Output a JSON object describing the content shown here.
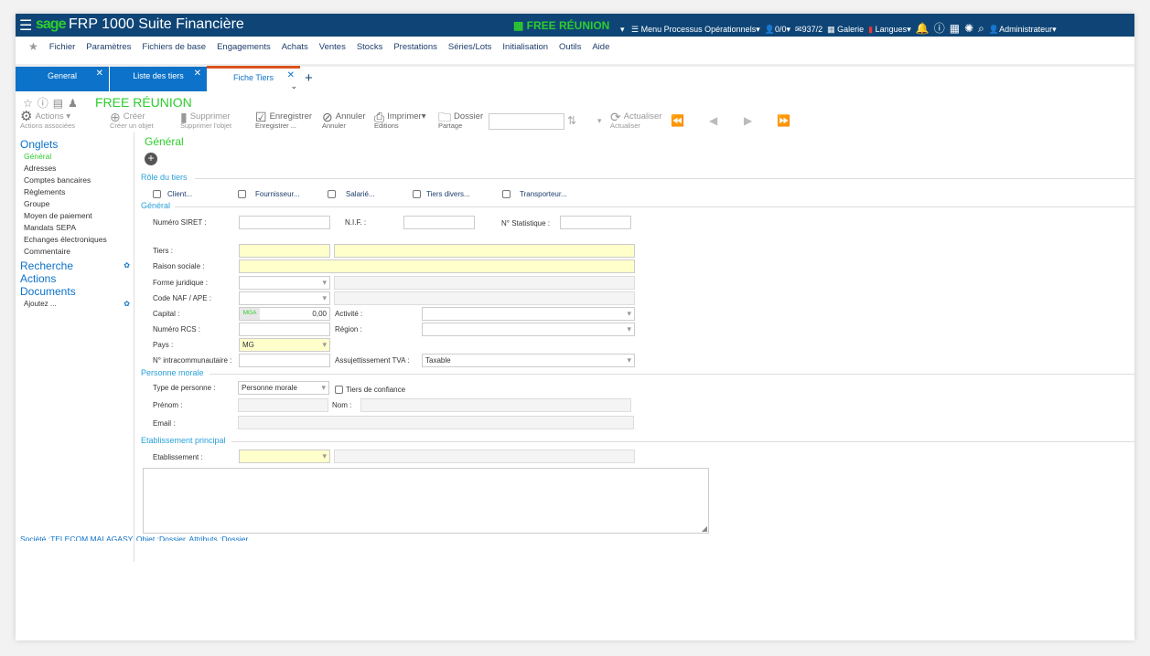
{
  "header": {
    "brand": "sage",
    "product": "FRP 1000 Suite Financière",
    "company": "FREE RÉUNION",
    "menu_processus": "Menu Processus Opérationnels",
    "users": "0/0",
    "mail": "937/2",
    "gallery": "Galerie",
    "languages": "Langues",
    "user": "Administrateur"
  },
  "menu": [
    "Fichier",
    "Paramètres",
    "Fichiers de base",
    "Engagements",
    "Achats",
    "Ventes",
    "Stocks",
    "Prestations",
    "Séries/Lots",
    "Initialisation",
    "Outils",
    "Aide"
  ],
  "tabs": [
    {
      "label": "General"
    },
    {
      "label": "Liste des tiers"
    },
    {
      "label": "Fiche Tiers"
    }
  ],
  "page_title": "FREE RÉUNION",
  "toolbar": {
    "actions": "Actions",
    "actions_sub": "Actions associées",
    "creer": "Créer",
    "creer_sub": "Créer un objet",
    "supprimer": "Supprimer",
    "supprimer_sub": "Supprimer l'objet",
    "enregistrer": "Enregistrer",
    "enregistrer_sub": "Enregistrer ...",
    "annuler": "Annuler",
    "annuler_sub": "Annuler",
    "imprimer": "Imprimer",
    "imprimer_sub": "Editions",
    "dossier": "Dossier",
    "dossier_sub": "Partage",
    "actualiser": "Actualiser",
    "actualiser_sub": "Actualiser"
  },
  "sidebar": {
    "onglets": "Onglets",
    "items": [
      "Général",
      "Adresses",
      "Comptes bancaires",
      "Règlements",
      "Groupe",
      "Moyen de paiement",
      "Mandats SEPA",
      "Echanges électroniques",
      "Commentaire"
    ],
    "recherche": "Recherche",
    "actions": "Actions",
    "documents": "Documents",
    "ajoutez": "Ajoutez ..."
  },
  "form": {
    "title": "Général",
    "role_section": "Rôle du tiers",
    "roles": [
      "Client...",
      "Fournisseur...",
      "Salarié...",
      "Tiers divers...",
      "Transporteur..."
    ],
    "general_section": "Général",
    "siret": "Numéro SIRET :",
    "nif": "N.I.F. :",
    "stat": "N° Statistique :",
    "tiers": "Tiers :",
    "raison": "Raison sociale :",
    "forme": "Forme juridique :",
    "naf": "Code NAF / APE :",
    "capital": "Capital :",
    "currency": "MGA",
    "capital_value": "0,00",
    "activite": "Activité :",
    "rcs": "Numéro RCS :",
    "region": "Région :",
    "pays": "Pays :",
    "pays_value": "MG",
    "intra": "N° intracommunautaire :",
    "tva": "Assujettissement TVA :",
    "tva_value": "Taxable",
    "pm_section": "Personne morale",
    "type": "Type de personne :",
    "type_value": "Personne morale",
    "confiance": "Tiers de confiance",
    "prenom": "Prénom :",
    "nom": "Nom :",
    "email": "Email :",
    "etab_section": "Etablissement principal",
    "etab": "Etablissement :"
  },
  "status": "Société :TELECOM MALAGASY, Objet :Dossier, Attributs :Dossier"
}
